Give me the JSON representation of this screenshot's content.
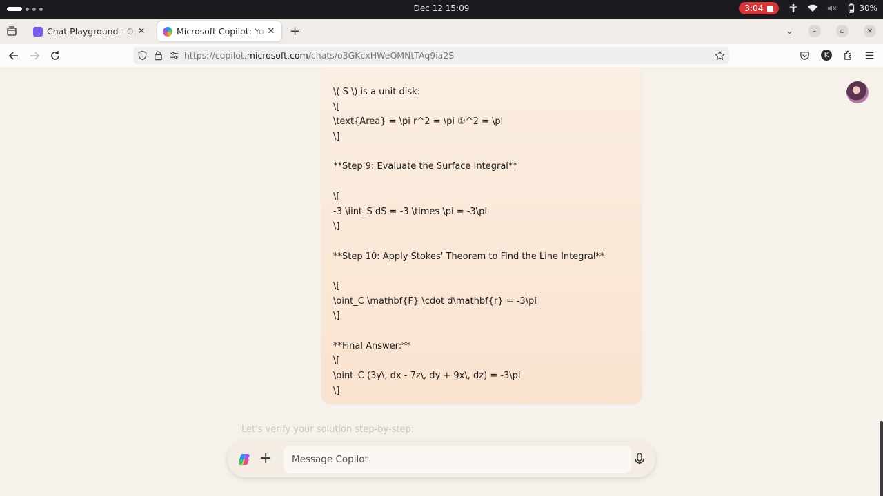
{
  "system": {
    "clock": "Dec 12  15:09",
    "recording": "3:04",
    "battery": "30%"
  },
  "tabs": [
    {
      "title": "Chat Playground - OpenAI",
      "active": false
    },
    {
      "title": "Microsoft Copilot: Your AI companion",
      "active": true
    }
  ],
  "url": {
    "prefix": "https://copilot.",
    "domain": "microsoft.com",
    "path": "/chats/o3GKcxHWeQMNtTAq9ia2S"
  },
  "account_initial": "K",
  "message": {
    "lines": [
      "\\( S \\) is a unit disk:",
      "\\[",
      "\\text{Area} = \\pi r^2 = \\pi ①^2 = \\pi",
      "\\]",
      "",
      "**Step 9: Evaluate the Surface Integral**",
      "",
      "\\[",
      "-3 \\iint_S dS = -3 \\times \\pi = -3\\pi",
      "\\]",
      "",
      "**Step 10: Apply Stokes' Theorem to Find the Line Integral**",
      "",
      "\\[",
      "\\oint_C \\mathbf{F} \\cdot d\\mathbf{r} = -3\\pi",
      "\\]",
      "",
      "**Final Answer:**",
      "\\[",
      "\\oint_C (3y\\, dx - 7z\\, dy + 9x\\, dz) = -3\\pi",
      "\\]"
    ]
  },
  "faded_prompt": "Let's verify your solution step-by-step:",
  "composer": {
    "placeholder": "Message Copilot"
  }
}
